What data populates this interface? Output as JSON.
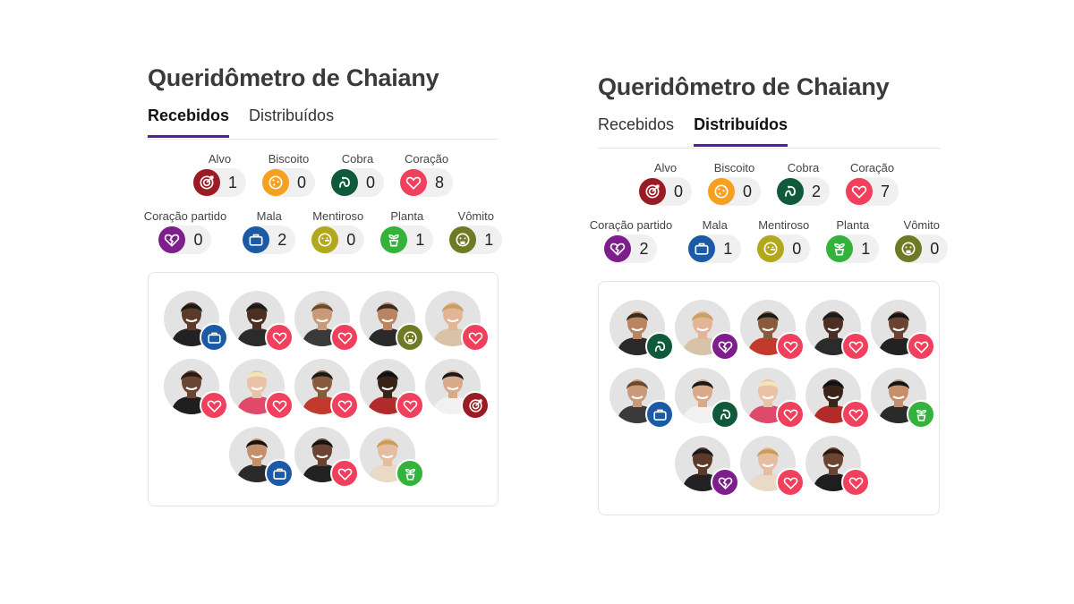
{
  "colors": {
    "alvo": "#9b1b24",
    "biscoito": "#f5a01f",
    "cobra": "#0f5a3a",
    "coracao": "#f0405d",
    "coracao_partido": "#7d1e8c",
    "mala": "#1b5aa6",
    "mentiroso": "#b2a81c",
    "planta": "#33b23c",
    "vomito": "#6f7a24",
    "tab_accent": "#5a1aa6"
  },
  "panels": [
    {
      "title": "Queridômetro de Chaiany",
      "tabs": [
        {
          "label": "Recebidos",
          "active": true
        },
        {
          "label": "Distribuídos",
          "active": false
        }
      ],
      "counts_row1": [
        {
          "label": "Alvo",
          "icon": "alvo",
          "value": "1"
        },
        {
          "label": "Biscoito",
          "icon": "biscoito",
          "value": "0"
        },
        {
          "label": "Cobra",
          "icon": "cobra",
          "value": "0"
        },
        {
          "label": "Coração",
          "icon": "coracao",
          "value": "8"
        }
      ],
      "counts_row2": [
        {
          "label": "Coração partido",
          "icon": "coracao_partido",
          "value": "0"
        },
        {
          "label": "Mala",
          "icon": "mala",
          "value": "2"
        },
        {
          "label": "Mentiroso",
          "icon": "mentiroso",
          "value": "0"
        },
        {
          "label": "Planta",
          "icon": "planta",
          "value": "1"
        },
        {
          "label": "Vômito",
          "icon": "vomito",
          "value": "1"
        }
      ],
      "people": [
        {
          "badge": "mala",
          "skin": "#5b3a29",
          "hair": "#1a1a1a",
          "shirt": "#222222"
        },
        {
          "badge": "coracao",
          "skin": "#4a2f22",
          "hair": "#1a1a1a",
          "shirt": "#2b2b2b"
        },
        {
          "badge": "coracao",
          "skin": "#c99a7a",
          "hair": "#6b4a2e",
          "shirt": "#3a3a3a"
        },
        {
          "badge": "vomito",
          "skin": "#b98462",
          "hair": "#3b2a1e",
          "shirt": "#2a2a2a"
        },
        {
          "badge": "coracao",
          "skin": "#e2b596",
          "hair": "#c9a060",
          "shirt": "#d8c3a8"
        },
        {
          "badge": "coracao",
          "skin": "#6a4532",
          "hair": "#2a1a12",
          "shirt": "#1e1e1e"
        },
        {
          "badge": "coracao",
          "skin": "#e9c2a8",
          "hair": "#f1e6b8",
          "shirt": "#e04a6a"
        },
        {
          "badge": "coracao",
          "skin": "#8a5a3d",
          "hair": "#1a1a1a",
          "shirt": "#c23a2e"
        },
        {
          "badge": "coracao",
          "skin": "#3a2418",
          "hair": "#111111",
          "shirt": "#b22a2a"
        },
        {
          "badge": "alvo",
          "skin": "#d9a98a",
          "hair": "#1a1a1a",
          "shirt": "#f1f1f1"
        },
        {
          "badge": "mala",
          "skin": "#c58f6c",
          "hair": "#141414",
          "shirt": "#2a2a2a"
        },
        {
          "badge": "coracao",
          "skin": "#6b4332",
          "hair": "#151515",
          "shirt": "#222222"
        },
        {
          "badge": "planta",
          "skin": "#e5bda0",
          "hair": "#c99d55",
          "shirt": "#e9d9c6"
        }
      ]
    },
    {
      "title": "Queridômetro de Chaiany",
      "tabs": [
        {
          "label": "Recebidos",
          "active": false
        },
        {
          "label": "Distribuídos",
          "active": true
        }
      ],
      "counts_row1": [
        {
          "label": "Alvo",
          "icon": "alvo",
          "value": "0"
        },
        {
          "label": "Biscoito",
          "icon": "biscoito",
          "value": "0"
        },
        {
          "label": "Cobra",
          "icon": "cobra",
          "value": "2"
        },
        {
          "label": "Coração",
          "icon": "coracao",
          "value": "7"
        }
      ],
      "counts_row2": [
        {
          "label": "Coração partido",
          "icon": "coracao_partido",
          "value": "2"
        },
        {
          "label": "Mala",
          "icon": "mala",
          "value": "1"
        },
        {
          "label": "Mentiroso",
          "icon": "mentiroso",
          "value": "0"
        },
        {
          "label": "Planta",
          "icon": "planta",
          "value": "1"
        },
        {
          "label": "Vômito",
          "icon": "vomito",
          "value": "0"
        }
      ],
      "people": [
        {
          "badge": "cobra",
          "skin": "#b98462",
          "hair": "#3b2a1e",
          "shirt": "#2a2a2a"
        },
        {
          "badge": "coracao_partido",
          "skin": "#e2b596",
          "hair": "#c9a060",
          "shirt": "#d8c3a8"
        },
        {
          "badge": "coracao",
          "skin": "#8a5a3d",
          "hair": "#1a1a1a",
          "shirt": "#c23a2e"
        },
        {
          "badge": "coracao",
          "skin": "#4a2f22",
          "hair": "#1a1a1a",
          "shirt": "#2b2b2b"
        },
        {
          "badge": "coracao",
          "skin": "#6b4332",
          "hair": "#151515",
          "shirt": "#222222"
        },
        {
          "badge": "mala",
          "skin": "#c99a7a",
          "hair": "#6b4a2e",
          "shirt": "#3a3a3a"
        },
        {
          "badge": "cobra",
          "skin": "#d9a98a",
          "hair": "#1a1a1a",
          "shirt": "#f1f1f1"
        },
        {
          "badge": "coracao",
          "skin": "#e9c2a8",
          "hair": "#f1e6b8",
          "shirt": "#e04a6a"
        },
        {
          "badge": "coracao",
          "skin": "#3a2418",
          "hair": "#111111",
          "shirt": "#b22a2a"
        },
        {
          "badge": "planta",
          "skin": "#c58f6c",
          "hair": "#141414",
          "shirt": "#2a2a2a"
        },
        {
          "badge": "coracao_partido",
          "skin": "#5b3a29",
          "hair": "#1a1a1a",
          "shirt": "#222222"
        },
        {
          "badge": "coracao",
          "skin": "#e5bda0",
          "hair": "#c99d55",
          "shirt": "#e9d9c6"
        },
        {
          "badge": "coracao",
          "skin": "#6a4532",
          "hair": "#2a1a12",
          "shirt": "#1e1e1e"
        }
      ]
    }
  ]
}
